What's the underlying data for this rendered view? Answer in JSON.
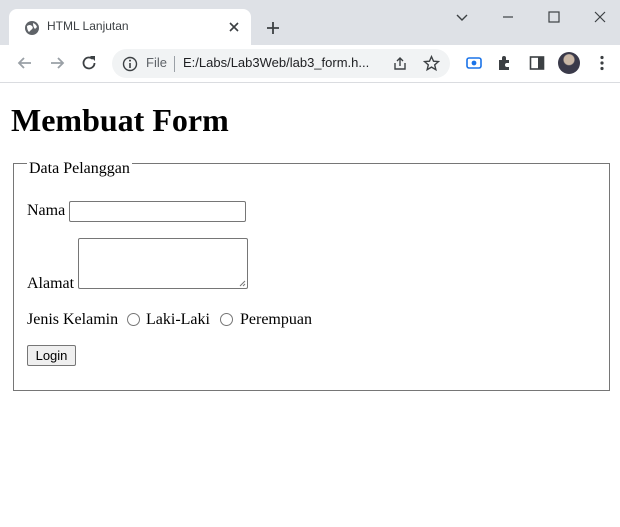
{
  "browser": {
    "tab_title": "HTML Lanjutan",
    "omnibox_scheme": "File",
    "omnibox_url": "E:/Labs/Lab3Web/lab3_form.h..."
  },
  "page": {
    "heading": "Membuat Form",
    "fieldset_legend": "Data Pelanggan",
    "fields": {
      "nama_label": "Nama",
      "nama_value": "",
      "alamat_label": "Alamat",
      "alamat_value": "",
      "gender_label": "Jenis Kelamin",
      "gender_options": [
        "Laki-Laki",
        "Perempuan"
      ]
    },
    "submit_label": "Login"
  }
}
